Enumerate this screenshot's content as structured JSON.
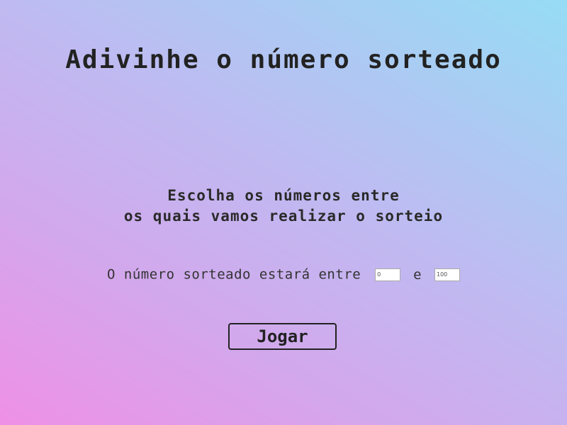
{
  "header": {
    "title": "Adivinhe o número sorteado"
  },
  "instructions": {
    "line1": "Escolha os números entre",
    "line2": "os quais vamos realizar o sorteio"
  },
  "range": {
    "label": "O número sorteado estará entre",
    "min_value": "0",
    "separator": "e",
    "max_value": "100"
  },
  "actions": {
    "play_label": "Jogar"
  },
  "colors": {
    "gradient_start": "#ef90e6",
    "gradient_end": "#96dcf4",
    "text": "#222222"
  }
}
